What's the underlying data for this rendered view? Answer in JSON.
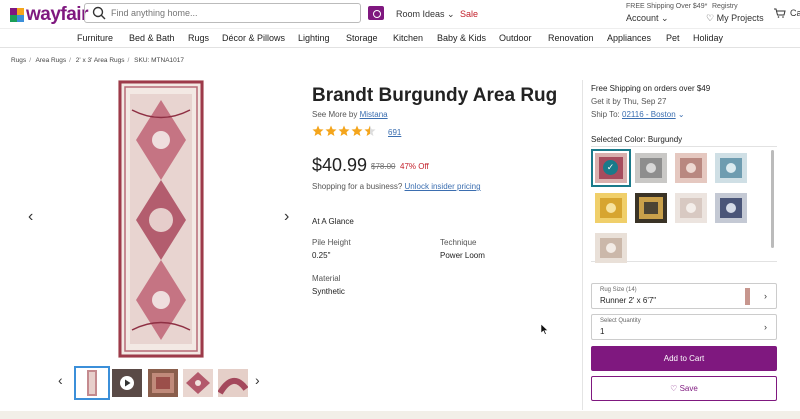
{
  "header": {
    "logo_text": "wayfair",
    "search_placeholder": "Find anything home...",
    "room_ideas": "Room Ideas",
    "sale": "Sale",
    "free_shipping": "FREE Shipping Over $49*",
    "account": "Account",
    "registry": "Registry",
    "my_projects": "My Projects",
    "cart": "Cart"
  },
  "nav": [
    "Furniture",
    "Bed & Bath",
    "Rugs",
    "Décor & Pillows",
    "Lighting",
    "Storage",
    "Kitchen",
    "Baby & Kids",
    "Outdoor",
    "Renovation",
    "Appliances",
    "Pet",
    "Holiday"
  ],
  "breadcrumb": [
    "Rugs",
    "Area Rugs",
    "2' x 3' Area Rugs",
    "SKU: MTNA1017"
  ],
  "product": {
    "title": "Brandt Burgundy Area Rug",
    "see_more": "See More by",
    "brand": "Mistana",
    "rating": 4.5,
    "reviews": "691",
    "price": "$40.99",
    "was_price": "$78.00",
    "discount": "47% Off",
    "business_text": "Shopping for a business?",
    "business_link": "Unlock insider pricing",
    "at_a_glance": "At A Glance",
    "specs": [
      {
        "label": "Pile Height",
        "value": "0.25\""
      },
      {
        "label": "Technique",
        "value": "Power Loom"
      },
      {
        "label": "Material",
        "value": "Synthetic"
      }
    ]
  },
  "shipping": {
    "line1": "Free Shipping on orders over $49",
    "line2": "Get it by Thu, Sep 27",
    "ship_to_label": "Ship To:",
    "ship_to_value": "02116 - Boston"
  },
  "color": {
    "selected_label": "Selected Color: Burgundy"
  },
  "rug_size": {
    "label": "Rug Size (14)",
    "value": "Runner 2' x 6'7\""
  },
  "quantity": {
    "label": "Select Quantity",
    "value": "1"
  },
  "buttons": {
    "add_to_cart": "Add to Cart",
    "save": "Save"
  },
  "colors": {
    "brand": "#7f187f",
    "link": "#3b6eb0",
    "sale": "#c3202b",
    "star": "#f4a51c"
  }
}
